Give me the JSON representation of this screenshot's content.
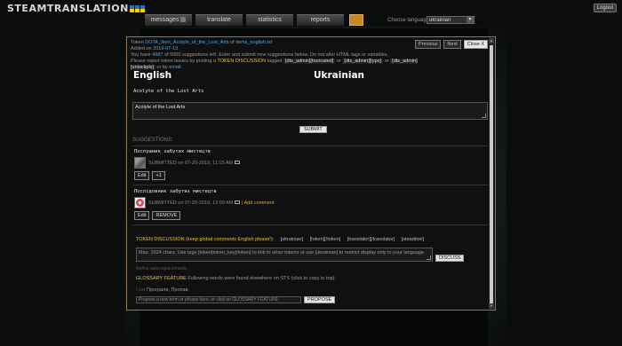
{
  "header": {
    "logo": "STEAMTRANSLATION",
    "logout": "Logout",
    "nav": [
      {
        "label": "messages"
      },
      {
        "label": "translate"
      },
      {
        "label": "statistics"
      },
      {
        "label": "reports"
      }
    ],
    "language_label": "Choose language:",
    "language_value": "ukrainian"
  },
  "modal": {
    "buttons": {
      "previous": "Previous",
      "next": "Next",
      "close": "Close X"
    },
    "info": {
      "token_prefix": "Token",
      "token_name": "DOTA_Item_Acolyte_of_the_Lost_Arts",
      "of": "of",
      "file": "items_english.txt",
      "added_prefix": "Added on",
      "added_date": "2019-07-19",
      "have_prefix": "You have",
      "have_count": "4987",
      "have_rest": "of 5000 suggestions left. Enter and submit new suggestions below. Do not alter HTML tags or variables.",
      "report_prefix": "Please report token issues by posting a",
      "report_link": "TOKEN DISCUSSION",
      "report_tagged": "tagged",
      "tag1": "[dts_admin][truncated]",
      "or1": "or",
      "tag2": "[dts_admin][typo]",
      "or2": "or",
      "tag3": "[dts_admin][unlockpls]",
      "or3": "or by",
      "email": "email."
    },
    "english_heading": "English",
    "ukrainian_heading": "Ukrainian",
    "source_text": "Acolyte of the Lost Arts",
    "textarea_value": "Acolyte of the Lost Arts",
    "submit": "SUBMIT",
    "suggestions_title": "SUGGESTIONS:",
    "suggestions": [
      {
        "text": "Послушник забутих мистецтв",
        "meta": "SUBMITTED on 07-20-2019, 11:15 AM",
        "buttons": [
          "Edit",
          "+1"
        ]
      },
      {
        "text": "Послідовник забутих мистецтв",
        "meta": "SUBMITTED on 07-20-2019, 12:09 AM",
        "comment": "| Add comment",
        "buttons": [
          "Edit",
          "REMOVE"
        ]
      }
    ],
    "discussion": {
      "title": "TOKEN DISCUSSION (keep global comments English please!):",
      "tags": [
        "[ukrainian]",
        "[token][/token]",
        "[translator][/translator]",
        "[steadmin]"
      ],
      "placeholder": "Max. 1024 chars. Use tags [token]token_key[/token] to link to other tokens or use [ukrainian] to restrict display only to your language.",
      "button": "DISCUSS"
    },
    "refine": "Refine auto-replacements",
    "glossary": {
      "title": "GLOSSARY FEATURE",
      "text": "Following words were found elsewhere on STS (click to copy to top):",
      "term_prefix": "Lost",
      "terms": "Програли, Пропав",
      "placeholder": "Propose a new term or phrase here, or click on GLOSSARY FEATURE",
      "button": "PROPOSE"
    }
  }
}
